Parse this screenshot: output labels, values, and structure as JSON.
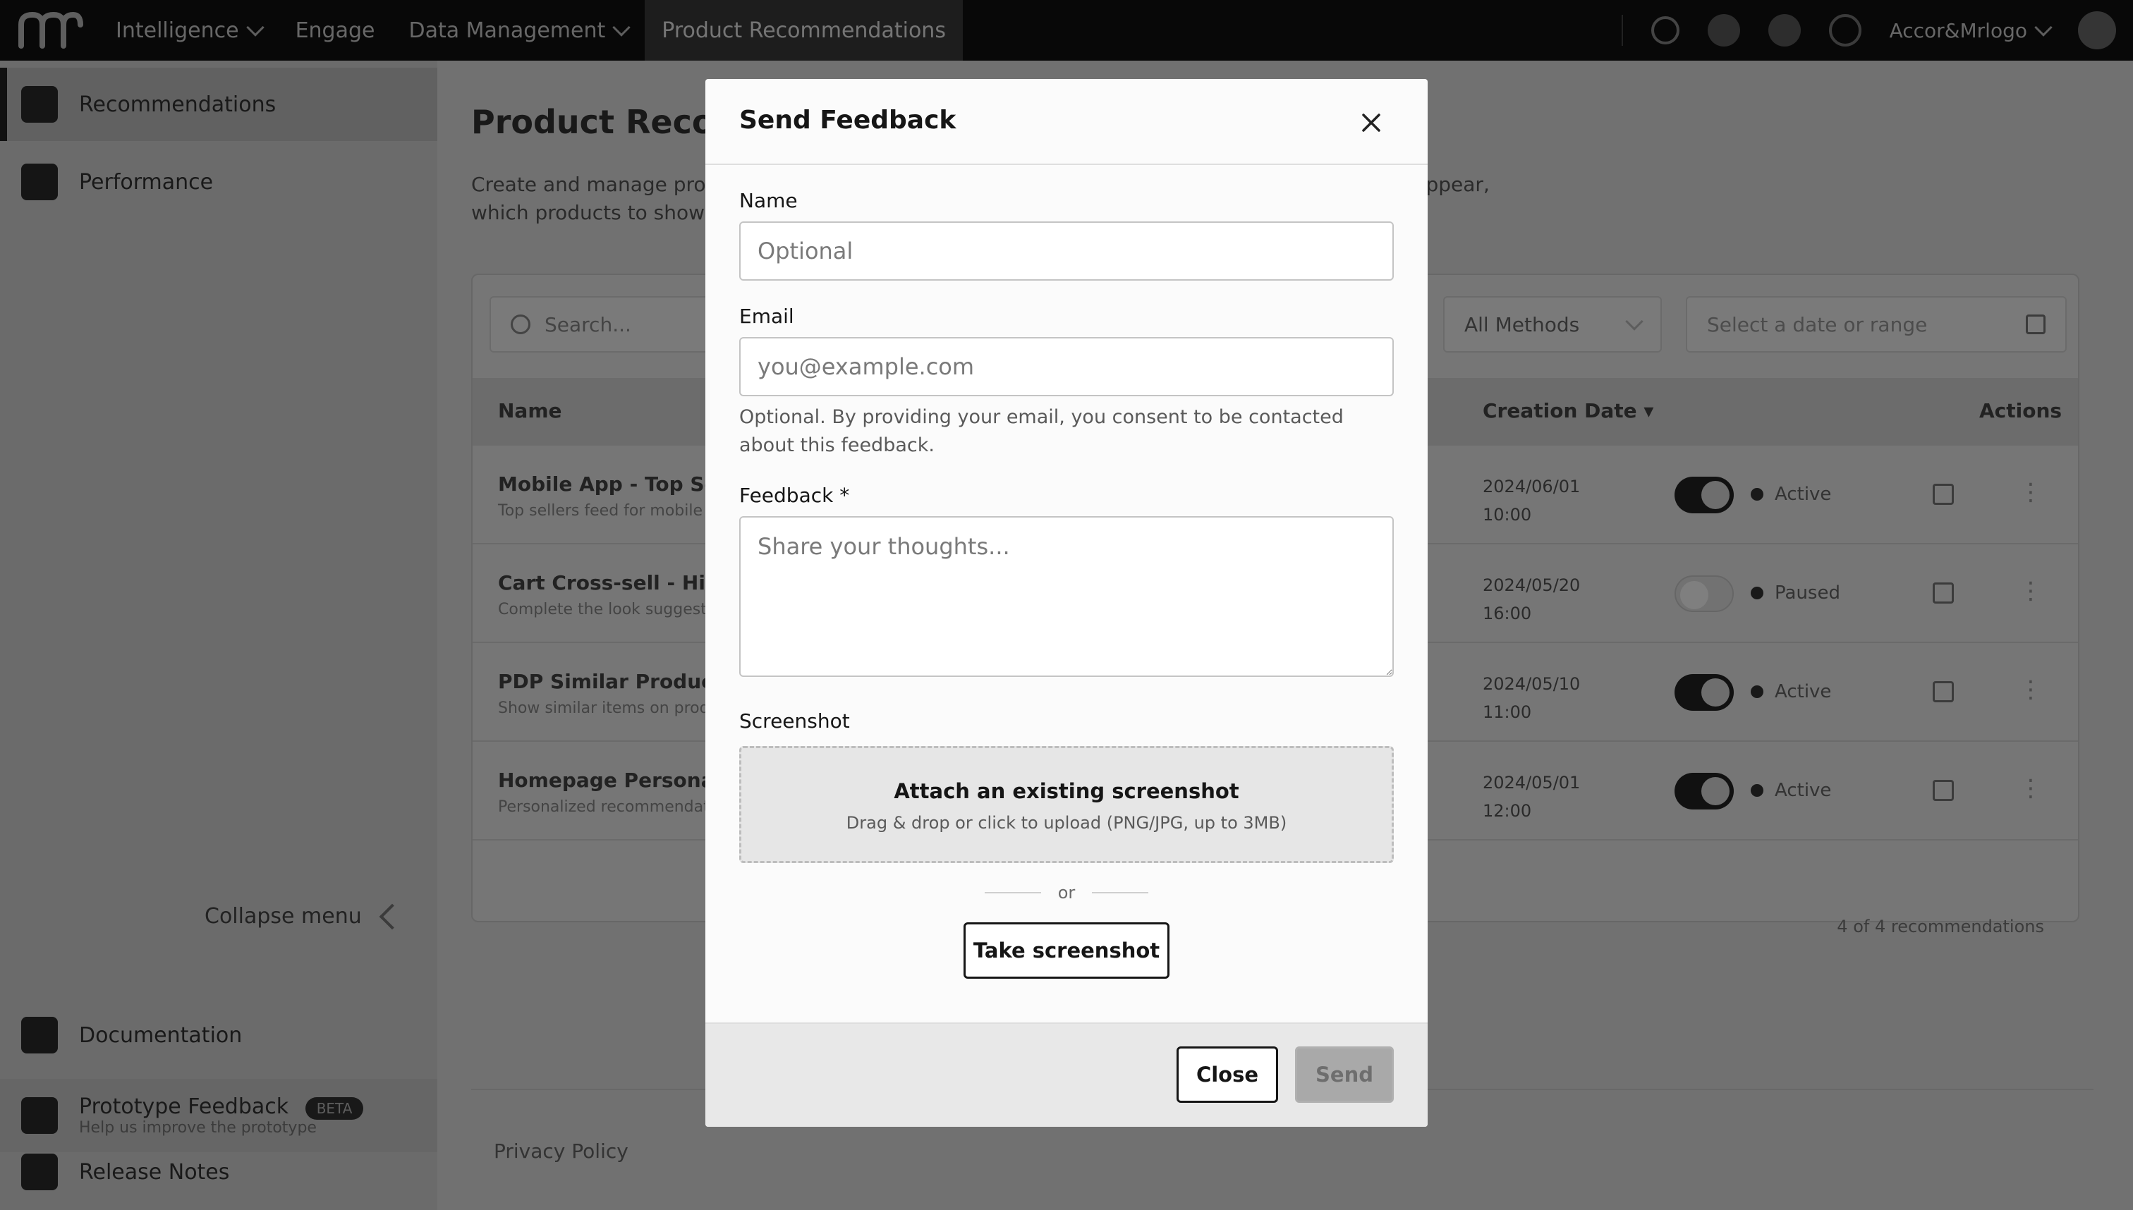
{
  "topnav": {
    "logo_icon": "brand-logo-icon",
    "items": [
      {
        "label": "Intelligence",
        "has_dropdown": true
      },
      {
        "label": "Engage",
        "has_dropdown": false
      },
      {
        "label": "Data Management",
        "has_dropdown": true
      },
      {
        "label": "Product Recommendations",
        "has_dropdown": false,
        "active": true
      }
    ],
    "account_label": "Accor&Mrlogo",
    "icons": [
      "search-icon",
      "notification-icon",
      "settings-icon",
      "help-icon",
      "avatar"
    ]
  },
  "sidebar": {
    "items": [
      {
        "label": "Recommendations",
        "icon": "recommendations-icon",
        "active": true
      },
      {
        "label": "Performance",
        "icon": "performance-icon"
      }
    ],
    "collapse_label": "Collapse menu",
    "bottom_items": [
      {
        "label": "Documentation",
        "icon": "documentation-icon"
      },
      {
        "label": "Prototype Feedback",
        "badge": "BETA",
        "sub": "Help us improve the prototype",
        "icon": "feedback-icon"
      },
      {
        "label": "Release Notes",
        "icon": "release-notes-icon"
      }
    ]
  },
  "main": {
    "title": "Product Recommendations",
    "description": "Create and manage product recommendation configurations. Control where recommendations appear, which products to show, and how they are ranked.",
    "search_placeholder": "Search...",
    "filter_label": "All Methods",
    "date_placeholder": "Select a date or range",
    "columns": {
      "name": "Name",
      "creation_date": "Creation Date ▾",
      "actions": "Actions"
    },
    "rows": [
      {
        "name": "Mobile App - Top Sellers",
        "desc": "Top sellers feed for mobile app",
        "date": "2024/06/01 10:00",
        "enabled": true,
        "status": "Active"
      },
      {
        "name": "Cart Cross-sell - High Margin",
        "desc": "Complete the look suggestions",
        "date": "2024/05/20 16:00",
        "enabled": false,
        "status": "Paused"
      },
      {
        "name": "PDP Similar Products",
        "desc": "Show similar items on product page",
        "date": "2024/05/10 11:00",
        "enabled": true,
        "status": "Active"
      },
      {
        "name": "Homepage Personalization",
        "desc": "Personalized recommendations",
        "date": "2024/05/01 12:00",
        "enabled": true,
        "status": "Active"
      }
    ],
    "pagination_text": "4 of 4 recommendations",
    "footer_link": "Privacy Policy"
  },
  "modal": {
    "title": "Send Feedback",
    "name_label": "Name",
    "name_placeholder": "Optional",
    "email_label": "Email",
    "email_placeholder": "you@example.com",
    "email_helper": "Optional. By providing your email, you consent to be contacted about this feedback.",
    "feedback_label": "Feedback *",
    "feedback_placeholder": "Share your thoughts...",
    "screenshot_label": "Screenshot",
    "dropzone_title": "Attach an existing screenshot",
    "dropzone_subtitle": "Drag & drop or click to upload (PNG/JPG, up to 3MB)",
    "or_text": "or",
    "take_screenshot_label": "Take screenshot",
    "close_label": "Close",
    "send_label": "Send",
    "send_disabled": true
  }
}
